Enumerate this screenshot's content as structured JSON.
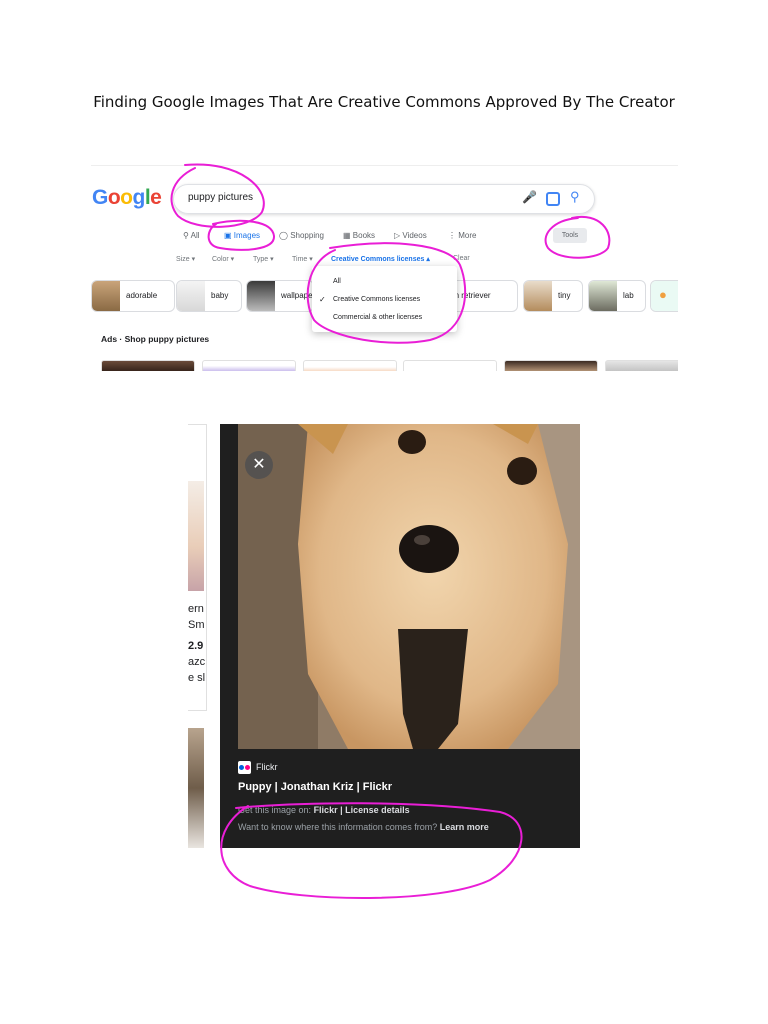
{
  "document": {
    "title": "Finding Google Images That Are Creative Commons Approved By The Creator"
  },
  "search_screenshot": {
    "logo": [
      "G",
      "o",
      "o",
      "g",
      "l",
      "e"
    ],
    "query": "puppy pictures",
    "tabs": [
      {
        "label": "All",
        "icon": "search-icon"
      },
      {
        "label": "Images",
        "icon": "image-icon"
      },
      {
        "label": "Shopping",
        "icon": "tag-icon"
      },
      {
        "label": "Books",
        "icon": "book-icon"
      },
      {
        "label": "Videos",
        "icon": "play-icon"
      },
      {
        "label": "More",
        "icon": "more-icon"
      }
    ],
    "tools_label": "Tools",
    "filters": [
      "Size",
      "Color",
      "Type",
      "Time",
      "Creative Commons licenses",
      "Clear"
    ],
    "chips": [
      "adorable",
      "baby",
      "wallpaper",
      "golden retriever",
      "tiny",
      "lab"
    ],
    "license_menu": {
      "items": [
        "All",
        "Creative Commons licenses",
        "Commercial & other licenses"
      ],
      "selected": "Creative Commons licenses"
    },
    "ads_heading": "Ads · Shop puppy pictures"
  },
  "preview_screenshot": {
    "left_fragments": [
      "ern",
      "Sm",
      "2.9",
      "azc",
      "e sl"
    ],
    "source_name": "Flickr",
    "image_title": "Puppy | Jonathan Kriz | Flickr",
    "get_image_label": "Get this image on:",
    "get_image_source": "Flickr",
    "separator": "|",
    "license_link": "License details",
    "info_question": "Want to know where this information comes from?",
    "learn_more": "Learn more"
  },
  "colors": {
    "annotation": "#e91ed6",
    "link_blue": "#1a73e8",
    "panel_bg": "#1f1f1f"
  }
}
